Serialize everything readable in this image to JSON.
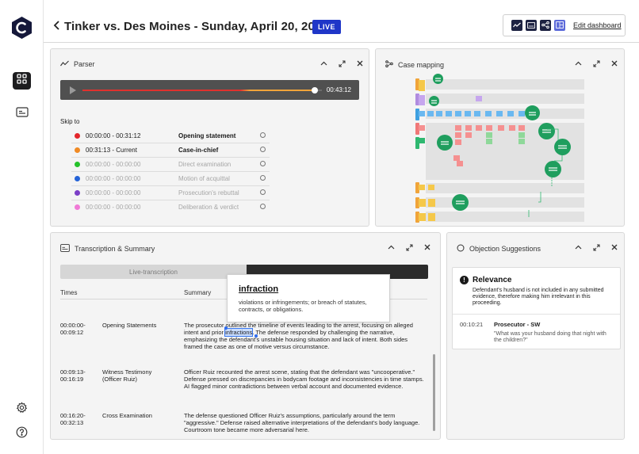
{
  "header": {
    "title": "Tinker vs. Des Moines - Sunday, April 20, 2025",
    "live_badge": "LIVE",
    "edit_dashboard": "Edit dashboard",
    "tools": [
      "line-chart-icon",
      "caption-icon",
      "share-graph-icon",
      "layout-icon"
    ]
  },
  "sidebar": {
    "items": [
      "grid-icon",
      "caption-icon"
    ],
    "bottom": [
      "gear-icon",
      "help-icon"
    ]
  },
  "parser": {
    "title": "Parser",
    "player": {
      "time": "00:43:12",
      "progress": 0.97
    },
    "skip_label": "Skip to",
    "segments": [
      {
        "range": "00:00:00 - 00:31:12",
        "name": "Opening statement",
        "color": "#e3262b",
        "state": "done"
      },
      {
        "range": "00:31:13  - Current",
        "name": "Case-in-chief",
        "color": "#f08a24",
        "state": "done"
      },
      {
        "range": "00:00:00 - 00:00:00",
        "name": "Direct examination",
        "color": "#25c22a",
        "state": "pending"
      },
      {
        "range": "00:00:00 - 00:00:00",
        "name": "Motion of acquittal",
        "color": "#2563d8",
        "state": "pending"
      },
      {
        "range": "00:00:00 - 00:00:00",
        "name": "Prosecution's rebuttal",
        "color": "#7b3fc7",
        "state": "pending"
      },
      {
        "range": "00:00:00 - 00:00:00",
        "name": "Deliberation & verdict",
        "color": "#f07ad6",
        "state": "pending"
      }
    ]
  },
  "case_mapping": {
    "title": "Case mapping"
  },
  "transcription": {
    "title": "Transcription & Summary",
    "tab_live": "Live-transcription",
    "col_times": "Times",
    "col_summary": "Summary",
    "rows": [
      {
        "time": "00:00:00-\n00:09:12",
        "topic": "Opening Statements",
        "pre": "The prosecutor outlined the timeline of events leading to the arrest, focusing on alleged intent and prior ",
        "highlight": "infractions",
        "post": ". The defense responded by challenging the narrative, emphasizing the defendant's unstable housing situation and lack of intent. Both sides framed the case as one of motive versus circumstance."
      },
      {
        "time": "00:09:13-\n00:16:19",
        "topic": "Witness Testimony\n(Officer Ruiz)",
        "pre": "Officer Ruiz recounted the arrest scene, stating that the defendant was \"uncooperative.\" Defense pressed on discrepancies in bodycam footage and inconsistencies in time stamps. AI flagged minor contradictions between verbal account and documented evidence.",
        "highlight": "",
        "post": ""
      },
      {
        "time": "00:16:20-\n00:32:13",
        "topic": "Cross Examination",
        "pre": "The defense questioned Officer Ruiz's assumptions, particularly around the term \"aggressive.\" Defense raised alternative interpretations of the defendant's body language. Courtroom tone became more adversarial here.",
        "highlight": "",
        "post": ""
      }
    ],
    "popup": {
      "word": "infraction",
      "definition": "violations or infringements; or breach of statutes, contracts, or obligations."
    }
  },
  "objections": {
    "title": "Objection Suggestions",
    "card": {
      "title": "Relevance",
      "description": "Defendant's husband is not included in any submitted evidence, therefore making him irrelevant in this proceeding.",
      "time": "00:10:21",
      "who": "Prosecutor - SW",
      "quote": "\"What was your husband doing that night with the children?\""
    }
  }
}
